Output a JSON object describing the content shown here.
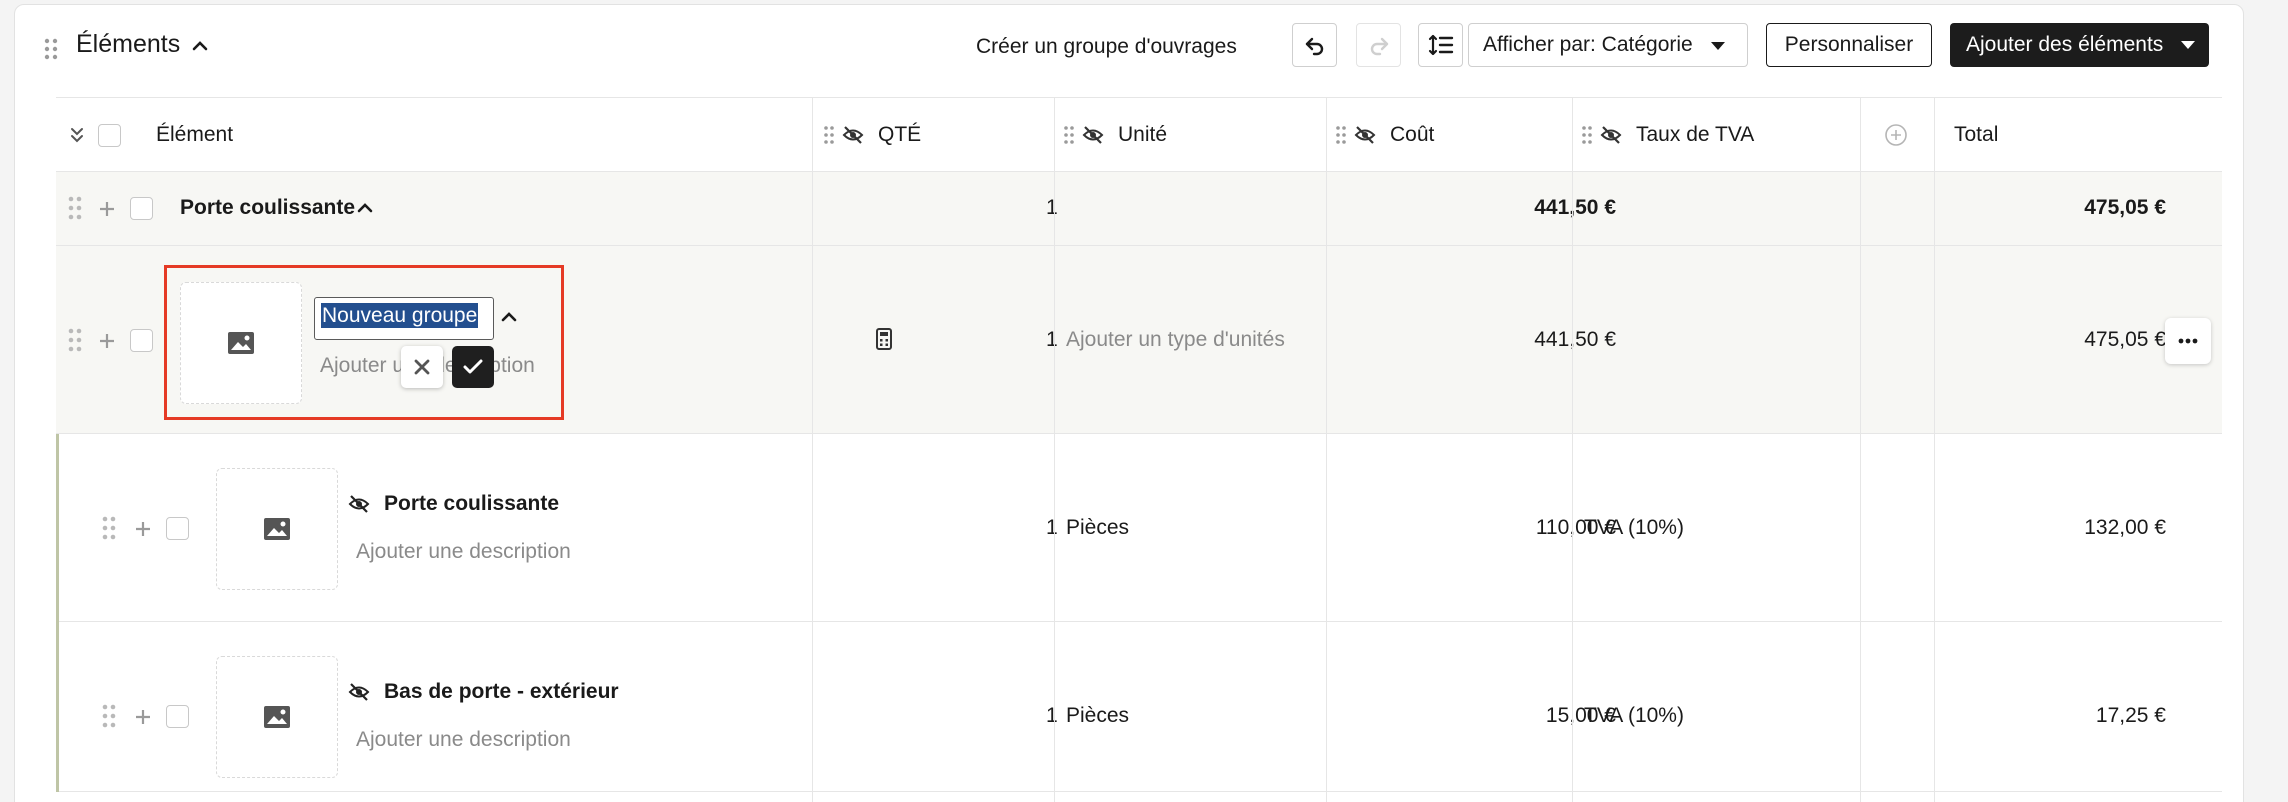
{
  "header": {
    "title": "Éléments",
    "create_group_label": "Créer un groupe d'ouvrages",
    "display_by_label": "Afficher par: Catégorie",
    "customize_label": "Personnaliser",
    "add_items_label": "Ajouter des éléments"
  },
  "columns": {
    "element": "Élément",
    "qty": "QTÉ",
    "unit": "Unité",
    "cost": "Coût",
    "vat": "Taux de TVA",
    "total": "Total"
  },
  "group": {
    "name": "Porte coulissante",
    "qty": "1",
    "cost": "441,50 €",
    "total": "475,05 €"
  },
  "editing_row": {
    "name_value": "Nouveau groupe",
    "description_placeholder": "Ajouter une description",
    "qty": "1",
    "unit_placeholder": "Ajouter un type d'unités",
    "cost": "441,50 €",
    "total": "475,05 €"
  },
  "items": [
    {
      "name": "Porte coulissante",
      "description": "Ajouter une description",
      "qty": "1",
      "unit": "Pièces",
      "cost": "110,00 €",
      "vat": "TVA (10%)",
      "total": "132,00 €"
    },
    {
      "name": "Bas de porte - extérieur",
      "description": "Ajouter une description",
      "qty": "1",
      "unit": "Pièces",
      "cost": "15,00 €",
      "vat": "TVA (10%)",
      "total": "17,25 €"
    }
  ],
  "colors": {
    "accent_dark": "#1c1c1c",
    "highlight_frame": "#e53a25",
    "selection": "#234f8f",
    "group_row_bg": "#f7f7f4"
  }
}
